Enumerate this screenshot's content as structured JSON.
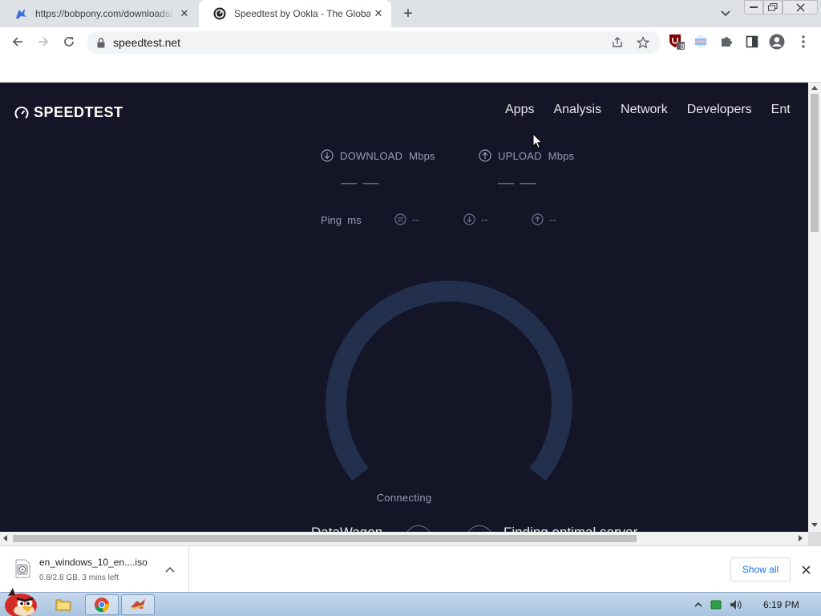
{
  "browser": {
    "tabs": [
      {
        "title": "https://bobpony.com/downloads/",
        "active": false
      },
      {
        "title": "Speedtest by Ookla - The Global Broadband Speed Test",
        "active": true
      }
    ],
    "address": {
      "url": "speedtest.net"
    },
    "extension_badge": "8"
  },
  "page": {
    "brand": "SPEEDTEST",
    "nav": [
      "Apps",
      "Analysis",
      "Network",
      "Developers",
      "Ent"
    ],
    "download": {
      "label": "DOWNLOAD",
      "unit": "Mbps",
      "value": "— —"
    },
    "upload": {
      "label": "UPLOAD",
      "unit": "Mbps",
      "value": "— —"
    },
    "ping": {
      "label": "Ping",
      "unit": "ms",
      "jitter": "--",
      "down": "--",
      "up": "--"
    },
    "status": "Connecting",
    "host": "DataWagon",
    "server": "Finding optimal server"
  },
  "downloads": {
    "filename": "en_windows_10_en....iso",
    "status": "0.8/2.8 GB, 3 mins left",
    "show_all": "Show all"
  },
  "taskbar": {
    "clock": "6:19 PM"
  },
  "colors": {
    "page_bg": "#141526",
    "gauge": "#22304d",
    "link": "#1a73e8"
  }
}
